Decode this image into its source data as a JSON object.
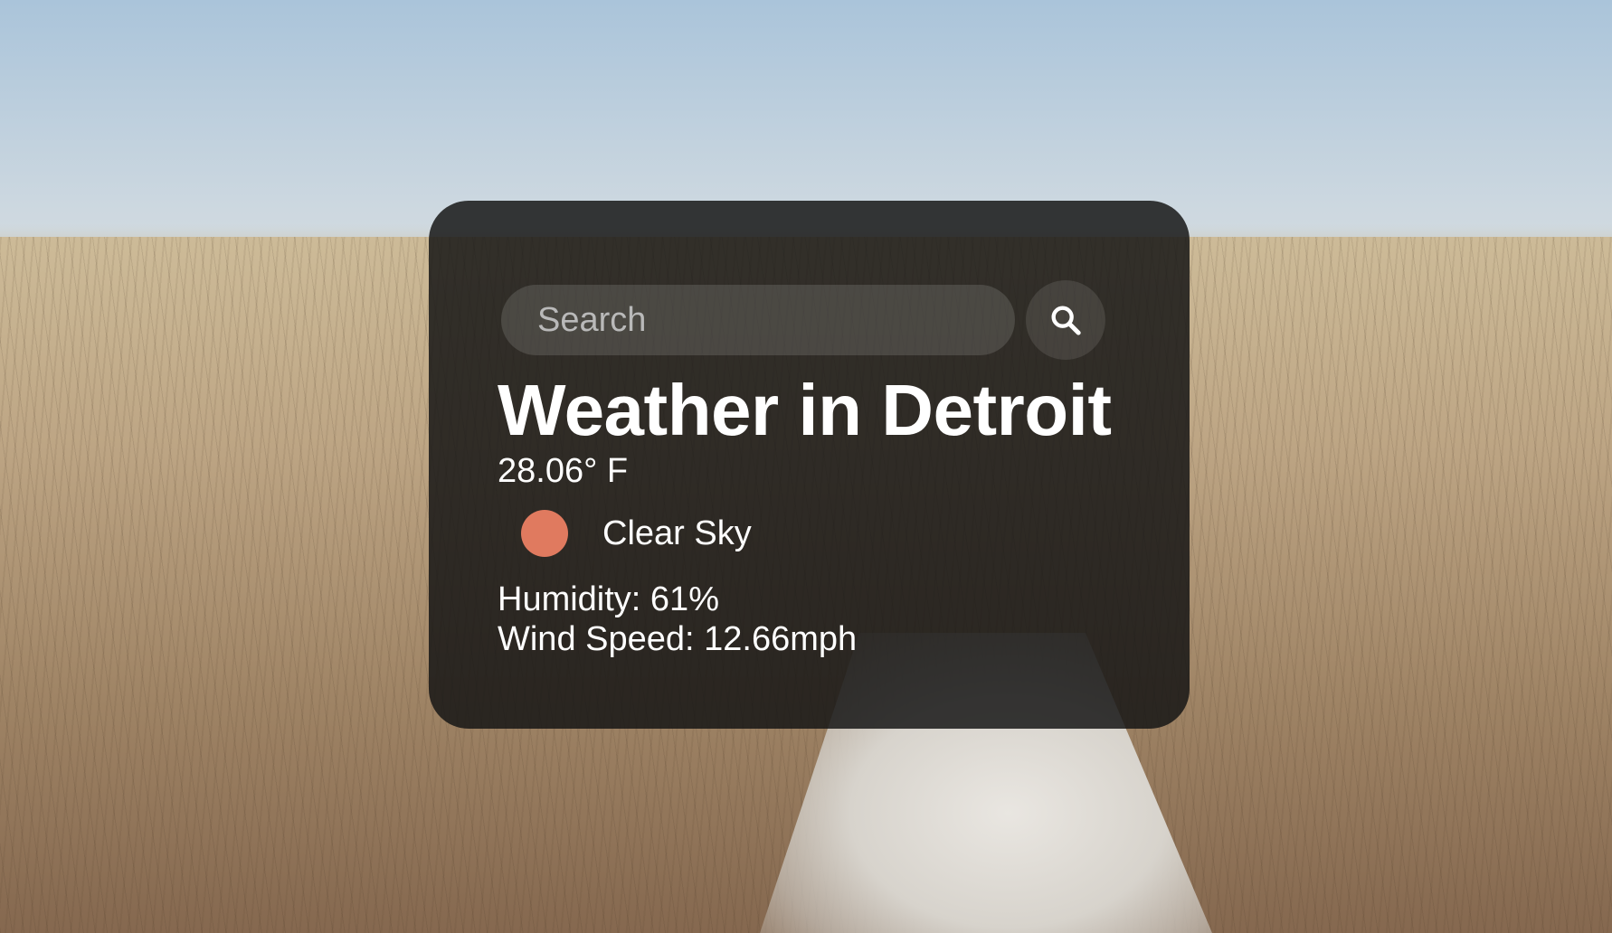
{
  "search": {
    "placeholder": "Search",
    "value": ""
  },
  "weather": {
    "title": "Weather in Detroit",
    "temperature": "28.06° F",
    "description": "Clear Sky",
    "icon": "sun-icon",
    "icon_color": "#e07a5f",
    "humidity": "Humidity: 61%",
    "wind_speed": "Wind Speed: 12.66mph"
  },
  "colors": {
    "card_background": "#141414",
    "text": "#ffffff"
  }
}
